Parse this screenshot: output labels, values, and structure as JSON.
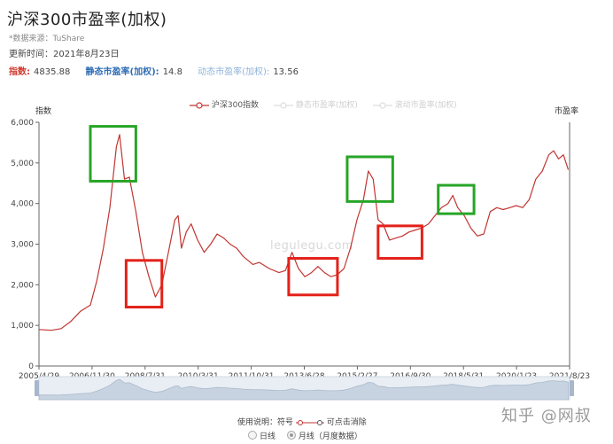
{
  "header": {
    "title": "沪深300市盈率(加权)",
    "source": "*数据来源：TuShare",
    "updated_label": "更新时间：",
    "updated_value": "2021年8月23日"
  },
  "stats": {
    "index_label": "指数:",
    "index_value": "4835.88",
    "static_pe_label": "静态市盈率(加权):",
    "static_pe_value": "14.8",
    "dynamic_pe_label": "动态市盈率(加权):",
    "dynamic_pe_value": "13.56"
  },
  "legend": {
    "series1": "沪深300指数",
    "series2": "静态市盈率(加权)",
    "series3": "滚动市盈率(加权)"
  },
  "axes": {
    "left_title": "指数",
    "right_title": "市盈率"
  },
  "watermark": "legulegu.com",
  "usage": {
    "text": "使用说明：符号",
    "suffix": "可点击消除"
  },
  "mode": {
    "daily": "日线",
    "monthly": "月线（月度数据）"
  },
  "corner_mark": "知乎 @网叔",
  "colors": {
    "series_line": "#c23531",
    "green_box": "#27a527",
    "red_box": "#e32119",
    "axis": "#666666",
    "slider_fill": "#c7d3e0"
  },
  "chart_data": {
    "type": "line",
    "title": "沪深300市盈率(加权)",
    "ylabel": "指数",
    "y2label": "市盈率",
    "ylim": [
      0,
      6000
    ],
    "yticks": [
      "0",
      "1,000",
      "2,000",
      "3,000",
      "4,000",
      "5,000",
      "6,000"
    ],
    "xticks": [
      "2005/4/29",
      "2006/11/30",
      "2008/7/31",
      "2010/3/31",
      "2011/10/31",
      "2013/6/28",
      "2015/2/27",
      "2016/9/30",
      "2018/5/31",
      "2020/1/23",
      "2021/8/23"
    ],
    "series": [
      {
        "name": "沪深300指数",
        "x": [
          2005.32,
          2005.7,
          2006.0,
          2006.3,
          2006.6,
          2006.9,
          2007.1,
          2007.3,
          2007.5,
          2007.7,
          2007.8,
          2007.95,
          2008.1,
          2008.3,
          2008.5,
          2008.7,
          2008.9,
          2009.1,
          2009.3,
          2009.5,
          2009.6,
          2009.7,
          2009.85,
          2010.0,
          2010.2,
          2010.4,
          2010.6,
          2010.8,
          2011.0,
          2011.2,
          2011.4,
          2011.6,
          2011.9,
          2012.1,
          2012.4,
          2012.7,
          2012.9,
          2013.1,
          2013.3,
          2013.5,
          2013.7,
          2013.9,
          2014.1,
          2014.3,
          2014.5,
          2014.7,
          2014.9,
          2015.1,
          2015.3,
          2015.45,
          2015.6,
          2015.75,
          2015.9,
          2016.1,
          2016.3,
          2016.5,
          2016.7,
          2016.9,
          2017.1,
          2017.3,
          2017.5,
          2017.7,
          2017.9,
          2018.05,
          2018.2,
          2018.4,
          2018.6,
          2018.8,
          2019.0,
          2019.2,
          2019.4,
          2019.6,
          2019.8,
          2020.0,
          2020.2,
          2020.4,
          2020.6,
          2020.8,
          2021.0,
          2021.15,
          2021.3,
          2021.45,
          2021.6
        ],
        "values": [
          900,
          880,
          920,
          1100,
          1350,
          1500,
          2100,
          2900,
          3900,
          5400,
          5700,
          4600,
          4650,
          3800,
          2800,
          2200,
          1700,
          2000,
          2800,
          3600,
          3700,
          2900,
          3300,
          3500,
          3100,
          2800,
          3000,
          3250,
          3150,
          3000,
          2900,
          2700,
          2500,
          2550,
          2400,
          2300,
          2350,
          2800,
          2400,
          2200,
          2300,
          2450,
          2300,
          2200,
          2250,
          2400,
          2900,
          3600,
          4100,
          4800,
          4600,
          3600,
          3500,
          3100,
          3150,
          3200,
          3300,
          3350,
          3400,
          3500,
          3700,
          3900,
          4000,
          4200,
          3900,
          3700,
          3400,
          3200,
          3250,
          3800,
          3900,
          3850,
          3900,
          3950,
          3900,
          4100,
          4600,
          4800,
          5200,
          5300,
          5100,
          5200,
          4835
        ]
      },
      {
        "name": "静态市盈率(加权)",
        "x": [],
        "values": []
      },
      {
        "name": "滚动市盈率(加权)",
        "x": [],
        "values": []
      }
    ],
    "annotations": [
      {
        "kind": "green-box",
        "x_range": [
          2006.9,
          2008.3
        ],
        "y_range": [
          4550,
          5900
        ]
      },
      {
        "kind": "red-box",
        "x_range": [
          2008.0,
          2009.1
        ],
        "y_range": [
          1450,
          2600
        ]
      },
      {
        "kind": "red-box",
        "x_range": [
          2013.0,
          2014.5
        ],
        "y_range": [
          1750,
          2650
        ]
      },
      {
        "kind": "green-box",
        "x_range": [
          2014.8,
          2016.2
        ],
        "y_range": [
          4050,
          5150
        ]
      },
      {
        "kind": "red-box",
        "x_range": [
          2015.75,
          2017.1
        ],
        "y_range": [
          2650,
          3450
        ]
      },
      {
        "kind": "green-box",
        "x_range": [
          2017.6,
          2018.7
        ],
        "y_range": [
          3750,
          4450
        ]
      }
    ],
    "grid": false,
    "legend_position": "top-center",
    "zoom_slider": true
  }
}
